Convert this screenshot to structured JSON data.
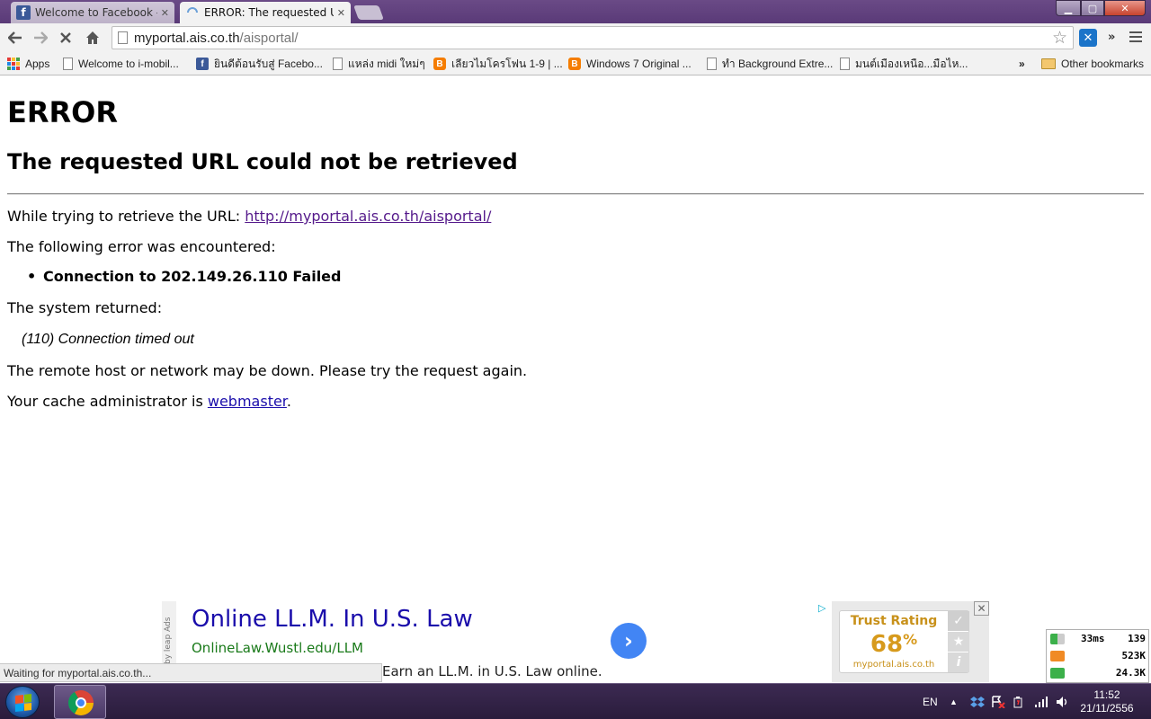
{
  "tabs": [
    {
      "title": "Welcome to Facebook - Lo",
      "favicon": "facebook-icon",
      "active": false
    },
    {
      "title": "ERROR: The requested URL",
      "favicon": "loading-spinner-icon",
      "active": true
    }
  ],
  "toolbar": {
    "url_host": "myportal.ais.co.th",
    "url_path": "/aisportal/"
  },
  "bookmarks": {
    "items": [
      {
        "label": "Apps",
        "icon": "apps-grid-icon"
      },
      {
        "label": "Welcome to i-mobil...",
        "icon": "page-icon"
      },
      {
        "label": "ยินดีต้อนรับสู่ Facebo...",
        "icon": "facebook-icon"
      },
      {
        "label": "แหล่ง midi ใหม่ๆ",
        "icon": "page-icon"
      },
      {
        "label": "เลียวไมโครโฟน 1-9 | ...",
        "icon": "blogger-icon"
      },
      {
        "label": "Windows 7 Original ...",
        "icon": "blogger-icon"
      },
      {
        "label": "ทำ Background Extre...",
        "icon": "page-icon"
      },
      {
        "label": "มนต์เมืองเหนือ...มือไห...",
        "icon": "page-icon"
      }
    ],
    "more": "»",
    "other": "Other bookmarks"
  },
  "page": {
    "heading": "ERROR",
    "subheading": "The requested URL could not be retrieved",
    "retrieve_prefix": "While trying to retrieve the URL: ",
    "retrieve_url": "http://myportal.ais.co.th/aisportal/",
    "error_intro": "The following error was encountered:",
    "error_item": "Connection to 202.149.26.110 Failed",
    "system_returned": "The system returned:",
    "system_message": "(110) Connection timed out",
    "remote_msg": "The remote host or network may be down. Please try the request again.",
    "admin_prefix": "Your cache administrator is ",
    "admin_link": "webmaster",
    "admin_suffix": "."
  },
  "ad": {
    "side_label": "by leap Ads",
    "title": "Online LL.M. In U.S. Law",
    "url": "OnlineLaw.Wustl.edu/LLM",
    "description": "Earn an LL.M. in U.S. Law online.",
    "trust_title": "Trust Rating",
    "trust_value": "68",
    "trust_unit": "%",
    "trust_domain": "myportal.ais.co.th"
  },
  "status": "Waiting for myportal.ais.co.th...",
  "netmeter": {
    "ping": "33ms",
    "count": "139",
    "down": "523K",
    "up": "24.3K"
  },
  "taskbar": {
    "lang": "EN",
    "time": "11:52",
    "date": "21/11/2556"
  },
  "colors": {
    "tabstrip": "#5a3a78",
    "link": "#1a0dab",
    "visited": "#551a8b",
    "ad_url": "#1a7a1a",
    "trust": "#d79a1c"
  }
}
